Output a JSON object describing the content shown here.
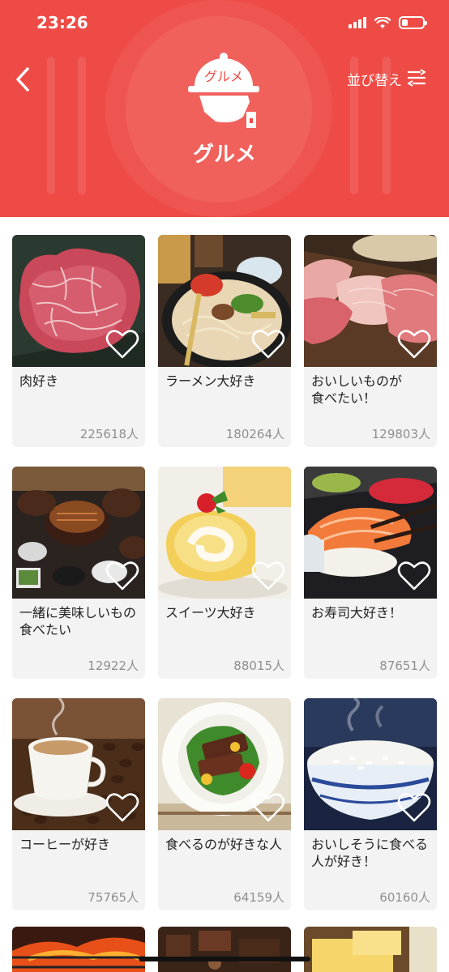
{
  "status_bar": {
    "time": "23:26"
  },
  "header": {
    "title": "グルメ",
    "icon_label": "グルメ",
    "sort_label": "並び替え",
    "accent_color": "#ef4b46"
  },
  "icons": {
    "back": "chevron-left-icon",
    "sort": "sort-icon",
    "category": "cloche-icon",
    "favorite": "heart-outline-icon"
  },
  "cards": [
    {
      "title": "肉好き",
      "count": "225618人",
      "image": "wagyu-beef"
    },
    {
      "title": "ラーメン大好き",
      "count": "180264人",
      "image": "ramen"
    },
    {
      "title": "おいしいものが\n食べたい！",
      "count": "129803人",
      "image": "sashimi"
    },
    {
      "title": "一緒に美味しいもの\n食べたい",
      "count": "12922人",
      "image": "unagi-set"
    },
    {
      "title": "スイーツ大好き",
      "count": "88015人",
      "image": "roll-cake"
    },
    {
      "title": "お寿司大好き！",
      "count": "87651人",
      "image": "sushi"
    },
    {
      "title": "コーヒーが好き",
      "count": "75765人",
      "image": "coffee"
    },
    {
      "title": "食べるのが好きな人",
      "count": "64159人",
      "image": "steak-salad"
    },
    {
      "title": "おいしそうに食べる\n人が好き！",
      "count": "60160人",
      "image": "rice"
    }
  ],
  "partial_cards": [
    {
      "image": "yakiniku-grill"
    },
    {
      "image": "chocolates"
    },
    {
      "image": "butter"
    }
  ]
}
